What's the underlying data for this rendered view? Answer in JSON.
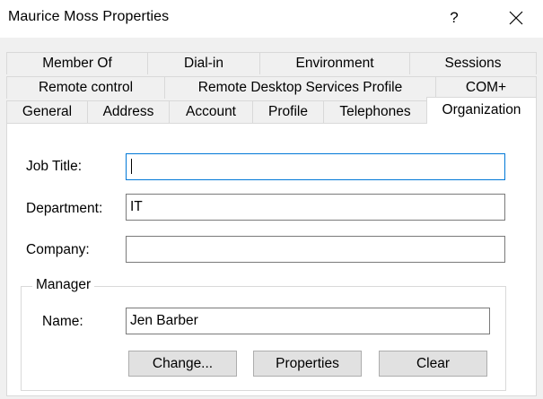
{
  "window": {
    "title": "Maurice Moss Properties",
    "help_label": "?"
  },
  "tabs": {
    "row1": [
      "Member Of",
      "Dial-in",
      "Environment",
      "Sessions"
    ],
    "row2": [
      "Remote control",
      "Remote Desktop Services Profile",
      "COM+"
    ],
    "row3": [
      "General",
      "Address",
      "Account",
      "Profile",
      "Telephones",
      "Organization"
    ],
    "active": "Organization"
  },
  "form": {
    "job_title_label": "Job Title:",
    "job_title_value": "",
    "department_label": "Department:",
    "department_value": "IT",
    "company_label": "Company:",
    "company_value": ""
  },
  "manager": {
    "legend": "Manager",
    "name_label": "Name:",
    "name_value": "Jen Barber",
    "change_button": "Change...",
    "properties_button": "Properties",
    "clear_button": "Clear"
  }
}
